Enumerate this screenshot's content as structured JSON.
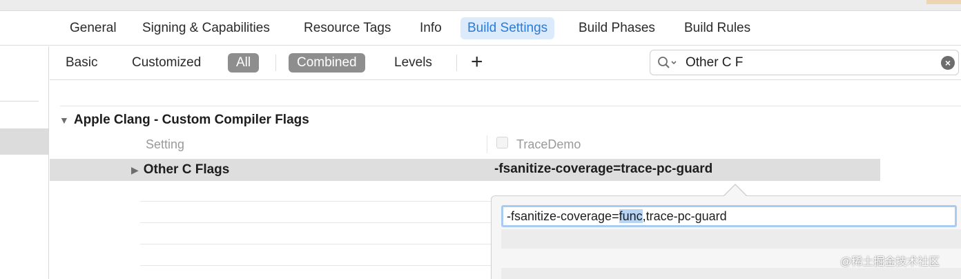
{
  "tabs": [
    {
      "label": "General",
      "active": false
    },
    {
      "label": "Signing & Capabilities",
      "active": false
    },
    {
      "label": "Resource Tags",
      "active": false
    },
    {
      "label": "Info",
      "active": false
    },
    {
      "label": "Build Settings",
      "active": true
    },
    {
      "label": "Build Phases",
      "active": false
    },
    {
      "label": "Build Rules",
      "active": false
    }
  ],
  "filter": {
    "basic": "Basic",
    "customized": "Customized",
    "all": "All",
    "combined": "Combined",
    "levels": "Levels",
    "add_icon": "plus-icon"
  },
  "search": {
    "value": "Other C F",
    "icon": "search-icon",
    "clear_icon": "clear-icon"
  },
  "section": {
    "title": "Apple Clang - Custom Compiler Flags",
    "column_setting": "Setting",
    "column_target": "TraceDemo"
  },
  "row": {
    "name": "Other C Flags",
    "value": "-fsanitize-coverage=trace-pc-guard"
  },
  "editor": {
    "text_before": "-fsanitize-coverage=",
    "text_selected": "func",
    "text_after": ",trace-pc-guard"
  },
  "watermark": "@稀土掘金技术社区",
  "colors": {
    "accent": "#2b7bd6",
    "active_tab_bg": "#dcebfb",
    "pill_bg": "#8e8e8e",
    "selected_row_bg": "#dedede",
    "text_highlight": "#b7d4f5"
  }
}
